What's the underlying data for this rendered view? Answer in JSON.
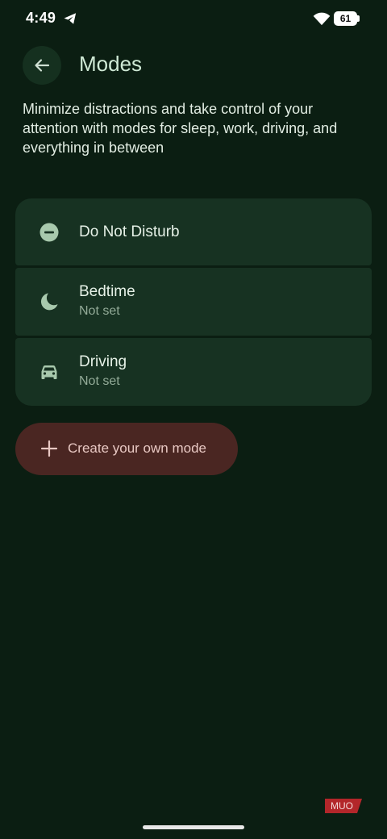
{
  "status_bar": {
    "time": "4:49",
    "battery_level": "61",
    "icons": [
      "telegram-icon",
      "wifi-icon",
      "battery-icon"
    ]
  },
  "header": {
    "back_icon": "arrow-left-icon",
    "title": "Modes"
  },
  "description": "Minimize distractions and take control of your attention with modes for sleep, work, driving, and everything in between",
  "modes": [
    {
      "icon": "do-not-disturb-icon",
      "name": "Do Not Disturb",
      "status": ""
    },
    {
      "icon": "moon-icon",
      "name": "Bedtime",
      "status": "Not set"
    },
    {
      "icon": "car-icon",
      "name": "Driving",
      "status": "Not set"
    }
  ],
  "create_button": {
    "icon": "plus-icon",
    "label": "Create your own mode"
  },
  "watermark": {
    "text": "MUO"
  },
  "colors": {
    "background": "#0b1e12",
    "card": "#173222",
    "accent_text": "#cfe9d5",
    "create_button_bg": "#4a2622",
    "create_button_text": "#e8c8c3",
    "icon_tint": "#a8c9ad"
  }
}
